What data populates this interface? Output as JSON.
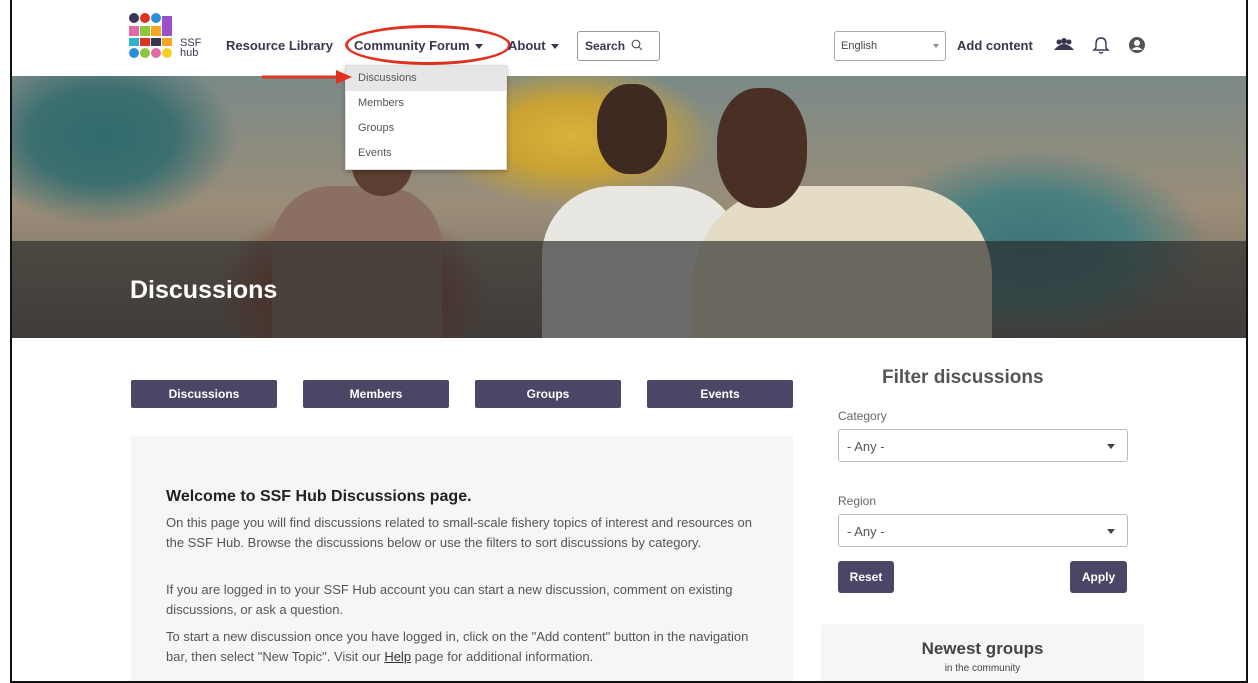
{
  "brand": {
    "logo_text_line1": "SSF",
    "logo_text_line2": "hub",
    "colors": {
      "primary": "#4c4565",
      "highlight": "#e0321f"
    }
  },
  "nav": {
    "resource_library": "Resource Library",
    "community_forum": "Community Forum",
    "about": "About",
    "search_label": "Search",
    "language": "English",
    "add_content": "Add content"
  },
  "dropdown": {
    "items": [
      {
        "label": "Discussions",
        "active": true
      },
      {
        "label": "Members"
      },
      {
        "label": "Groups"
      },
      {
        "label": "Events"
      }
    ]
  },
  "hero": {
    "title": "Discussions"
  },
  "tabs": [
    "Discussions",
    "Members",
    "Groups",
    "Events"
  ],
  "welcome": {
    "heading": "Welcome to SSF Hub Discussions page.",
    "p1": "On this page you will find discussions related to small-scale fishery topics of interest and resources on the SSF Hub. Browse the discussions below or use the filters to sort discussions by category.",
    "p2": "If you are logged in to your SSF Hub account you can start a new discussion, comment on existing discussions, or ask a question.",
    "p3_before": "To start a new discussion once you have logged in, click on the \"Add content\" button in the navigation bar, then select \"New Topic\". Visit our ",
    "p3_link": "Help",
    "p3_after": " page for additional information."
  },
  "filter": {
    "title": "Filter discussions",
    "category_label": "Category",
    "category_value": "- Any -",
    "region_label": "Region",
    "region_value": "- Any -",
    "reset": "Reset",
    "apply": "Apply"
  },
  "newest": {
    "title": "Newest groups",
    "subtitle": "in the community"
  }
}
